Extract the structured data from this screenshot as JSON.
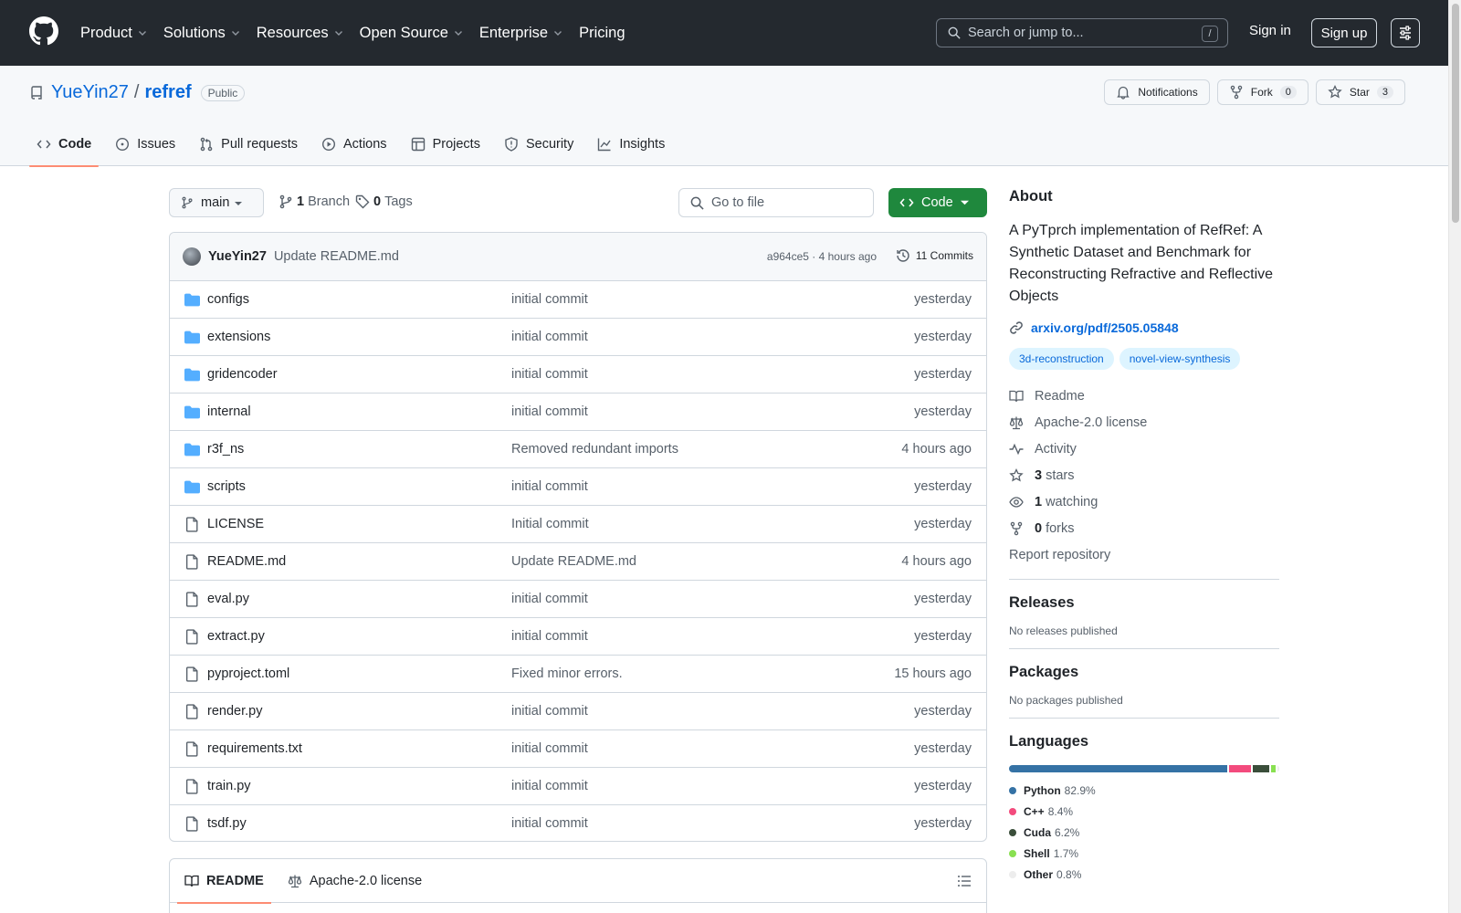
{
  "topnav": {
    "items": [
      {
        "label": "Product",
        "dropdown": true
      },
      {
        "label": "Solutions",
        "dropdown": true
      },
      {
        "label": "Resources",
        "dropdown": true
      },
      {
        "label": "Open Source",
        "dropdown": true
      },
      {
        "label": "Enterprise",
        "dropdown": true
      },
      {
        "label": "Pricing",
        "dropdown": false
      }
    ],
    "search_placeholder": "Search or jump to...",
    "search_shortcut": "/",
    "signin": "Sign in",
    "signup": "Sign up"
  },
  "repo": {
    "owner": "YueYin27",
    "separator": "/",
    "name": "refref",
    "visibility": "Public",
    "actions": {
      "notifications": "Notifications",
      "fork": "Fork",
      "fork_count": "0",
      "star": "Star",
      "star_count": "3"
    },
    "tabs": [
      "Code",
      "Issues",
      "Pull requests",
      "Actions",
      "Projects",
      "Security",
      "Insights"
    ],
    "active_tab": "Code"
  },
  "branchbar": {
    "branch": "main",
    "branch_count": "1",
    "branch_label": "Branch",
    "tag_count": "0",
    "tag_label": "Tags",
    "goto_placeholder": "Go to file",
    "code_button": "Code"
  },
  "latest_commit": {
    "author": "YueYin27",
    "message": "Update README.md",
    "meta": "a964ce5 · 4 hours ago",
    "commits": "11 Commits"
  },
  "files": [
    {
      "name": "configs",
      "type": "dir",
      "message": "initial commit",
      "time": "yesterday"
    },
    {
      "name": "extensions",
      "type": "dir",
      "message": "initial commit",
      "time": "yesterday"
    },
    {
      "name": "gridencoder",
      "type": "dir",
      "message": "initial commit",
      "time": "yesterday"
    },
    {
      "name": "internal",
      "type": "dir",
      "message": "initial commit",
      "time": "yesterday"
    },
    {
      "name": "r3f_ns",
      "type": "dir",
      "message": "Removed redundant imports",
      "time": "4 hours ago"
    },
    {
      "name": "scripts",
      "type": "dir",
      "message": "initial commit",
      "time": "yesterday"
    },
    {
      "name": "LICENSE",
      "type": "file",
      "message": "Initial commit",
      "time": "yesterday"
    },
    {
      "name": "README.md",
      "type": "file",
      "message": "Update README.md",
      "time": "4 hours ago"
    },
    {
      "name": "eval.py",
      "type": "file",
      "message": "initial commit",
      "time": "yesterday"
    },
    {
      "name": "extract.py",
      "type": "file",
      "message": "initial commit",
      "time": "yesterday"
    },
    {
      "name": "pyproject.toml",
      "type": "file",
      "message": "Fixed minor errors.",
      "time": "15 hours ago"
    },
    {
      "name": "render.py",
      "type": "file",
      "message": "initial commit",
      "time": "yesterday"
    },
    {
      "name": "requirements.txt",
      "type": "file",
      "message": "initial commit",
      "time": "yesterday"
    },
    {
      "name": "train.py",
      "type": "file",
      "message": "initial commit",
      "time": "yesterday"
    },
    {
      "name": "tsdf.py",
      "type": "file",
      "message": "initial commit",
      "time": "yesterday"
    }
  ],
  "readme_tabs": {
    "readme": "README",
    "license": "Apache-2.0 license"
  },
  "about": {
    "title": "About",
    "description": "A PyTprch implementation of RefRef: A Synthetic Dataset and Benchmark for Reconstructing Refractive and Reflective Objects",
    "link": "arxiv.org/pdf/2505.05848",
    "topics": [
      "3d-reconstruction",
      "novel-view-synthesis"
    ],
    "items": [
      {
        "icon": "book-icon",
        "bold": "",
        "text": "Readme"
      },
      {
        "icon": "law-icon",
        "bold": "",
        "text": "Apache-2.0 license"
      },
      {
        "icon": "pulse-icon",
        "bold": "",
        "text": "Activity"
      },
      {
        "icon": "star-icon",
        "bold": "3",
        "text": "stars"
      },
      {
        "icon": "eye-icon",
        "bold": "1",
        "text": "watching"
      },
      {
        "icon": "fork-icon",
        "bold": "0",
        "text": "forks"
      }
    ],
    "report": "Report repository"
  },
  "releases": {
    "title": "Releases",
    "empty": "No releases published"
  },
  "packages": {
    "title": "Packages",
    "empty": "No packages published"
  },
  "languages": {
    "title": "Languages",
    "items": [
      {
        "name": "Python",
        "pct": "82.9%",
        "value": 82.9,
        "color": "#3572A5"
      },
      {
        "name": "C++",
        "pct": "8.4%",
        "value": 8.4,
        "color": "#f34b7d"
      },
      {
        "name": "Cuda",
        "pct": "6.2%",
        "value": 6.2,
        "color": "#3A4E3A"
      },
      {
        "name": "Shell",
        "pct": "1.7%",
        "value": 1.7,
        "color": "#89e051"
      },
      {
        "name": "Other",
        "pct": "0.8%",
        "value": 0.8,
        "color": "#ededed"
      }
    ]
  }
}
